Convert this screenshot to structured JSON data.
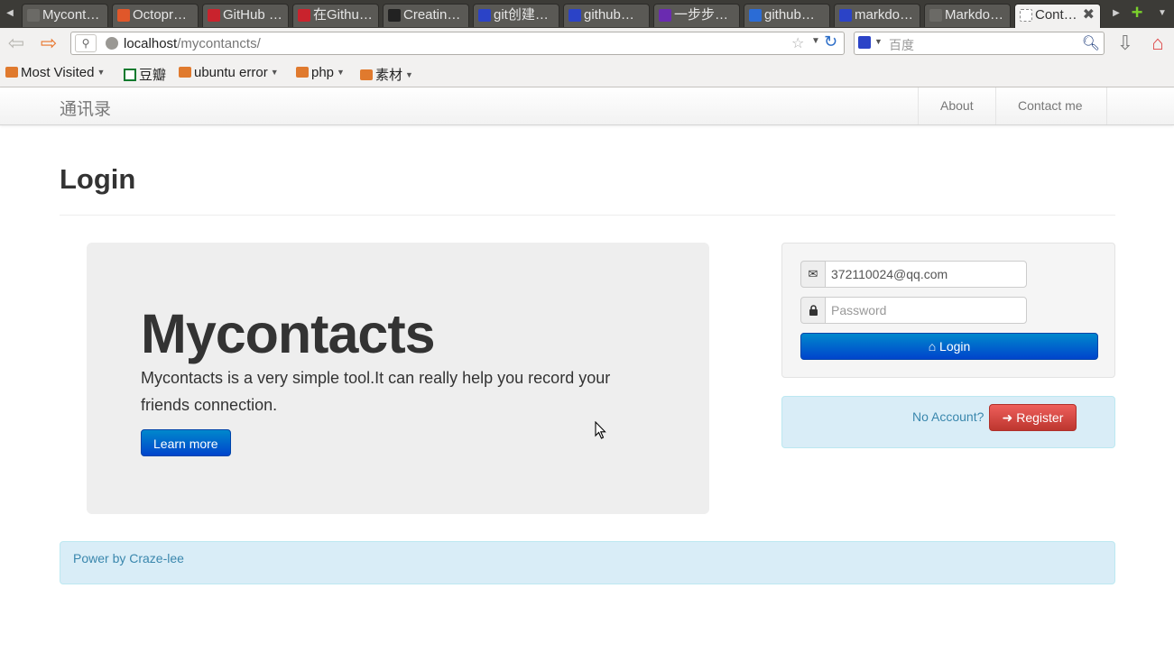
{
  "browser": {
    "tabs": [
      {
        "label": "Mycont…",
        "favicon": "page-icon",
        "color": "#6b6a66"
      },
      {
        "label": "Octopr…",
        "favicon": "octopress-icon",
        "color": "#e0572a"
      },
      {
        "label": "GitHub …",
        "favicon": "github-red-icon",
        "color": "#c9232d"
      },
      {
        "label": "在Githu…",
        "favicon": "github-red-icon",
        "color": "#c9232d"
      },
      {
        "label": "Creatin…",
        "favicon": "github-octocat-icon",
        "color": "#222222"
      },
      {
        "label": "git创建…",
        "favicon": "baidu-icon",
        "color": "#2b43c7"
      },
      {
        "label": "github…",
        "favicon": "baidu-icon",
        "color": "#2b43c7"
      },
      {
        "label": "一步步…",
        "favicon": "purple-flag-icon",
        "color": "#6a2bb0"
      },
      {
        "label": "github…",
        "favicon": "blue-globe-icon",
        "color": "#2b6cd6"
      },
      {
        "label": "markdo…",
        "favicon": "baidu-icon",
        "color": "#2b43c7"
      },
      {
        "label": "Markdo…",
        "favicon": "page-icon",
        "color": "#6b6a66"
      },
      {
        "label": "Cont…",
        "favicon": "blank-page-icon",
        "color": "#ffffff",
        "active": true
      }
    ],
    "url": {
      "host": "localhost",
      "path": "/mycontancts/"
    },
    "search": {
      "placeholder": "百度"
    },
    "bookmarks": [
      {
        "label": "Most Visited",
        "icon": "most-visited-icon",
        "dropdown": true
      },
      {
        "label": "豆瓣",
        "icon": "douban-icon",
        "dropdown": false
      },
      {
        "label": "ubuntu error",
        "icon": "folder-icon",
        "dropdown": true
      },
      {
        "label": "php",
        "icon": "folder-icon",
        "dropdown": true
      },
      {
        "label": "素材",
        "icon": "folder-icon",
        "dropdown": true
      }
    ]
  },
  "site": {
    "brand": "通讯录",
    "nav": [
      {
        "label": "About"
      },
      {
        "label": "Contact me"
      }
    ]
  },
  "page": {
    "title": "Login",
    "hero": {
      "heading": "Mycontacts",
      "text": "Mycontacts is a very simple tool.It can really help you record your friends connection.",
      "button": "Learn more"
    },
    "login": {
      "email_value": "372110024@qq.com",
      "password_placeholder": "Password",
      "button": "Login"
    },
    "register": {
      "prompt": "No Account?",
      "button": "Register"
    },
    "footer": "Power by Craze-lee"
  },
  "colors": {
    "primary": "#0055cc",
    "danger": "#da4f49",
    "info_text": "#3a87ad",
    "info_bg": "#d9edf7"
  }
}
